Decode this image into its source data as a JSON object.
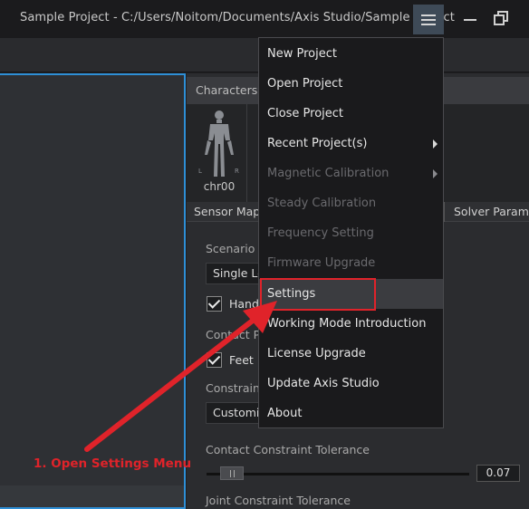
{
  "window": {
    "title": "Sample Project - C:/Users/Noitom/Documents/Axis Studio/Sample Project"
  },
  "characters_panel": {
    "header": "Characters",
    "character_name": "chr00",
    "figure_left_mark": "L",
    "figure_right_mark": "R"
  },
  "tabs": {
    "left": "Sensor Map",
    "right": "Solver Parame"
  },
  "settings_form": {
    "scenario_label": "Scenario",
    "scenario_value": "Single Le",
    "hand_label": "Hand",
    "contact_label": "Contact Po",
    "feet_label": "Feet",
    "constraint_label": "Constraint",
    "constraint_value": "Customiz",
    "contact_tolerance_label": "Contact Constraint Tolerance",
    "contact_tolerance_value": "0.07",
    "joint_tolerance_label": "Joint Constraint Tolerance"
  },
  "menu": {
    "items": [
      {
        "label": "New Project",
        "enabled": true,
        "submenu": false
      },
      {
        "label": "Open Project",
        "enabled": true,
        "submenu": false
      },
      {
        "label": "Close Project",
        "enabled": true,
        "submenu": false
      },
      {
        "label": "Recent Project(s)",
        "enabled": true,
        "submenu": true
      },
      {
        "label": "Magnetic Calibration",
        "enabled": false,
        "submenu": true
      },
      {
        "label": "Steady Calibration",
        "enabled": false,
        "submenu": false
      },
      {
        "label": "Frequency Setting",
        "enabled": false,
        "submenu": false
      },
      {
        "label": "Firmware Upgrade",
        "enabled": false,
        "submenu": false
      },
      {
        "label": "Settings",
        "enabled": true,
        "submenu": false,
        "highlighted": true
      },
      {
        "label": "Working Mode Introduction",
        "enabled": true,
        "submenu": false
      },
      {
        "label": "License Upgrade",
        "enabled": true,
        "submenu": false
      },
      {
        "label": "Update Axis Studio",
        "enabled": true,
        "submenu": false
      },
      {
        "label": "About",
        "enabled": true,
        "submenu": false
      }
    ]
  },
  "annotation": {
    "text": "1. Open Settings Menu",
    "color": "#e0232a"
  },
  "icons": {
    "menu_button": "hamburger-icon",
    "minimize": "minimize-icon",
    "restore": "restore-icon",
    "character": "humanoid-figure-icon"
  }
}
